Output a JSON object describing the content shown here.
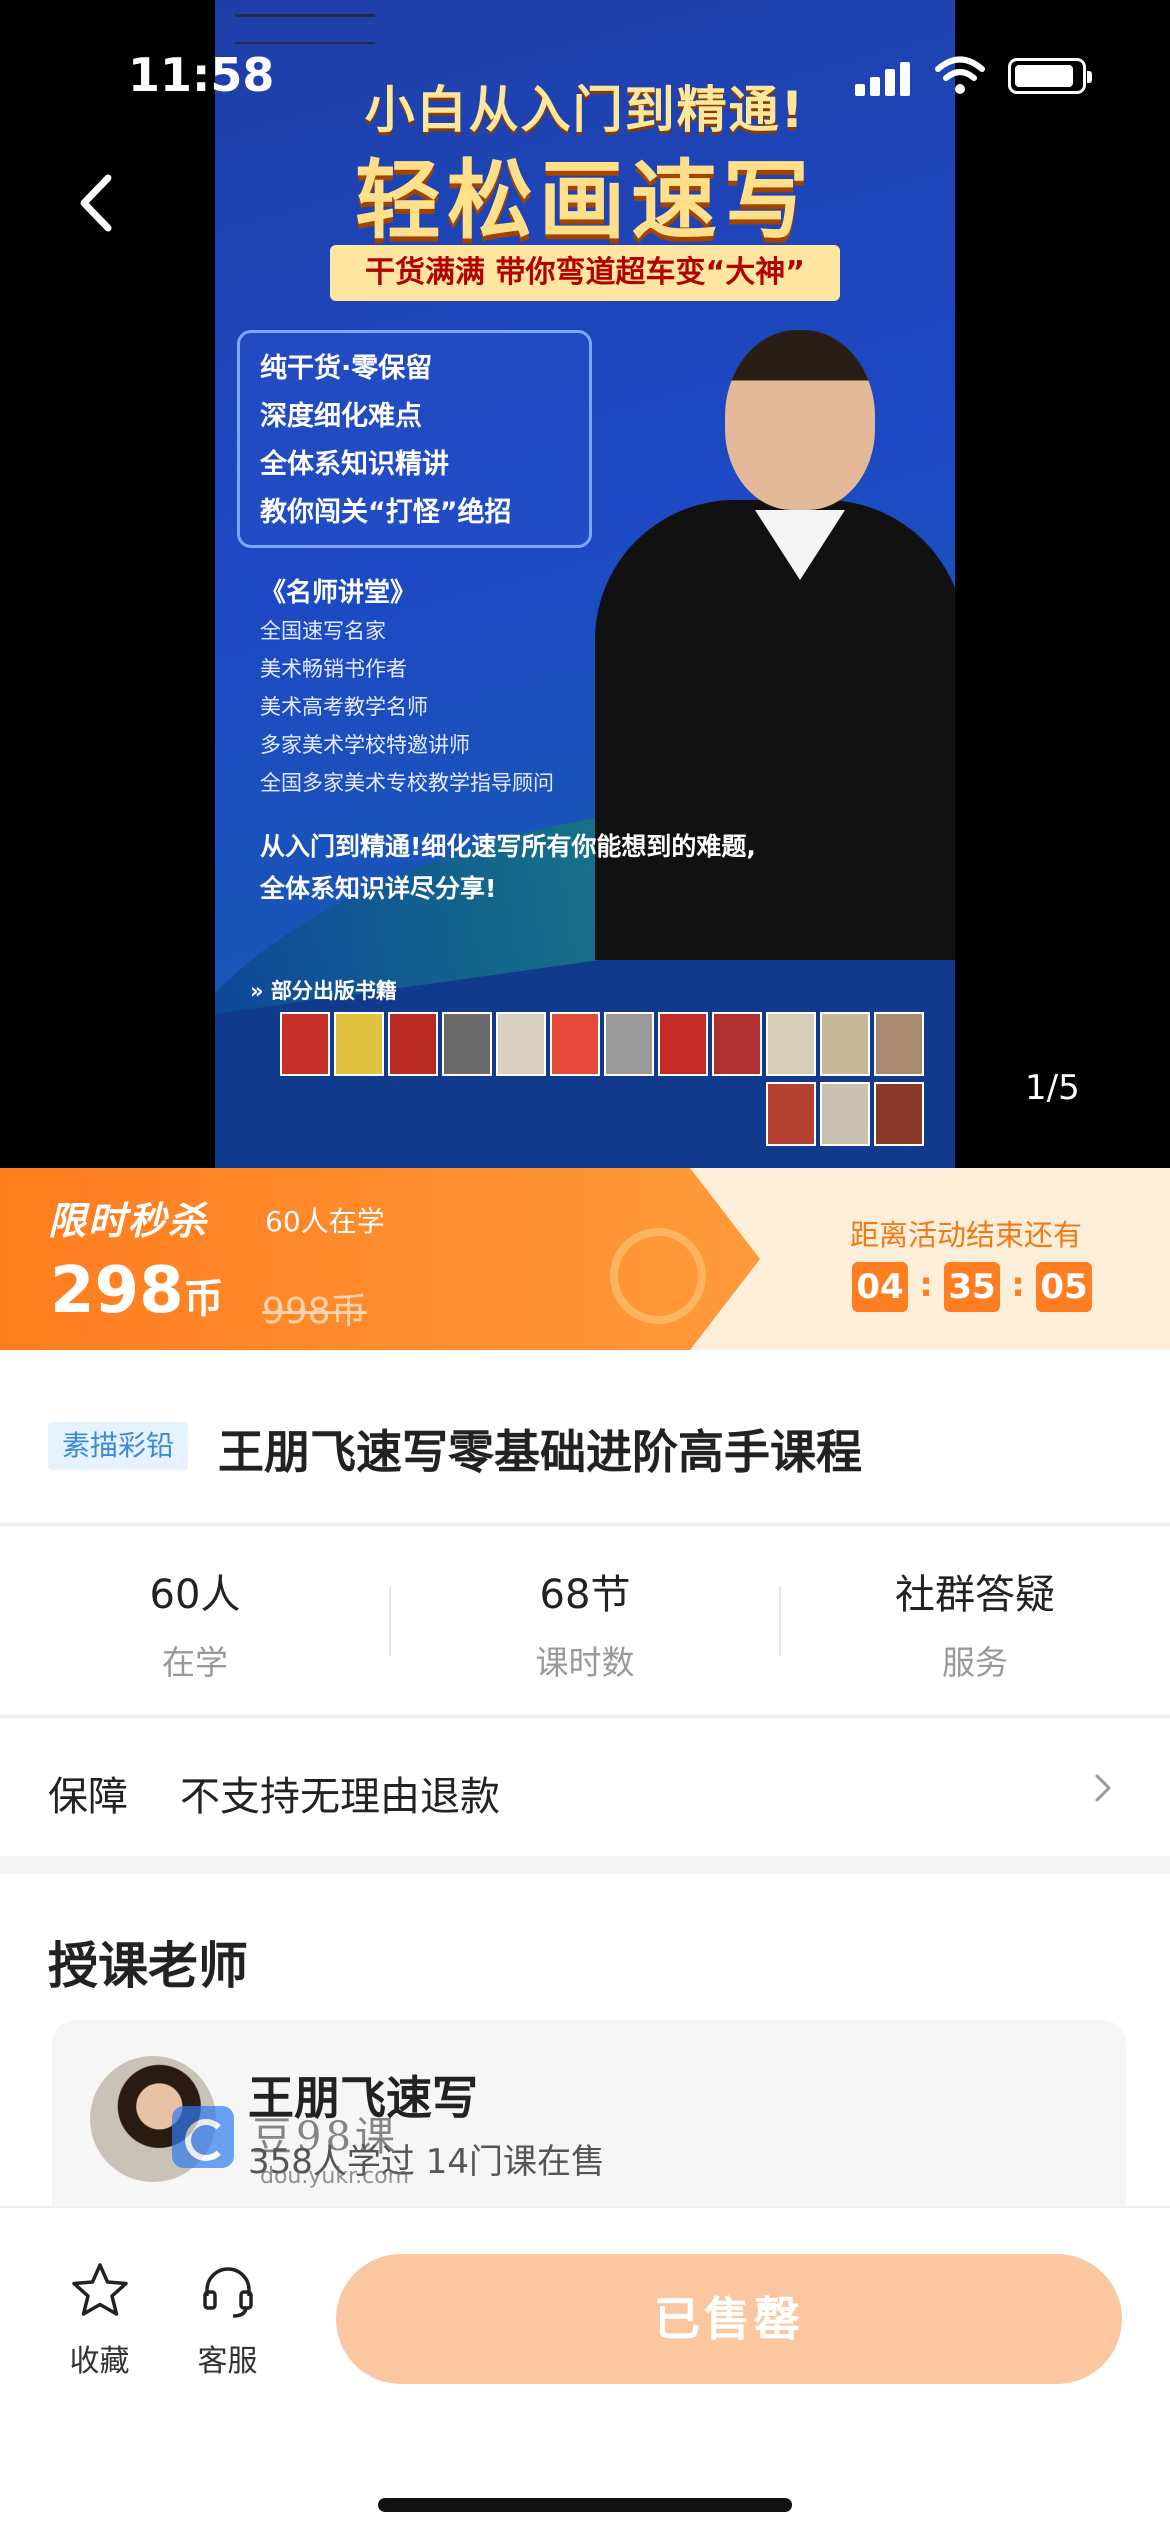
{
  "status_bar": {
    "time": "11:58"
  },
  "poster": {
    "title_line1": "小白从入门到精通!",
    "title_line2": "轻松画速写",
    "ribbon": "干货满满  带你弯道超车变“大神”",
    "features": [
      "纯干货·零保留",
      "深度细化难点",
      "全体系知识精讲",
      "教你闯关“打怪”绝招"
    ],
    "section_title": "《名师讲堂》",
    "credentials": [
      "全国速写名家",
      "美术畅销书作者",
      "美术高考教学名师",
      "多家美术学校特邀讲师",
      "全国多家美术专校教学指导顾问"
    ],
    "description": "从入门到精通!细化速写所有你能想到的难题,全体系知识详尽分享!",
    "books_label": "部分出版书籍"
  },
  "gallery": {
    "indicator": "1/5"
  },
  "flash_sale": {
    "title": "限时秒杀",
    "learners": "60人在学",
    "price": "298",
    "currency": "币",
    "original_price": "998币",
    "countdown_label": "距离活动结束还有",
    "hours": "04",
    "minutes": "35",
    "seconds": "05",
    "separator": ":"
  },
  "course": {
    "category": "素描彩铅",
    "title": "王朋飞速写零基础进阶高手课程"
  },
  "stats": [
    {
      "value": "60人",
      "label": "在学"
    },
    {
      "value": "68节",
      "label": "课时数"
    },
    {
      "value": "社群答疑",
      "label": "服务"
    }
  ],
  "guarantee": {
    "label": "保障",
    "value": "不支持无理由退款"
  },
  "teacher_section": {
    "title": "授课老师",
    "name": "王朋飞速写",
    "meta": "358人学过  14门课在售"
  },
  "watermark": {
    "text": "豆98课",
    "url": "dou.yukr.com"
  },
  "bottom_bar": {
    "favorite_label": "收藏",
    "service_label": "客服",
    "buy_label": "已售罄"
  },
  "colors": {
    "accent": "#ff7e22",
    "sold_out": "#fbc7a0",
    "tag_bg": "#e6f3ff"
  }
}
